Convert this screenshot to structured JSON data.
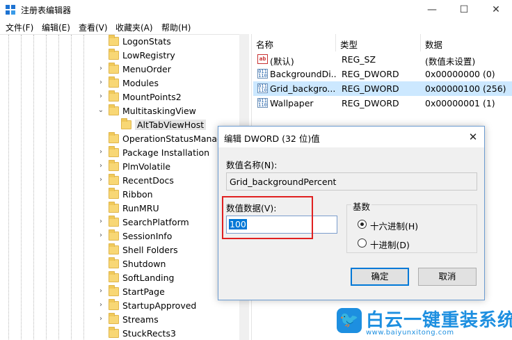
{
  "window": {
    "title": "注册表编辑器",
    "minimize": "—",
    "maximize": "☐",
    "close": "✕"
  },
  "menu": [
    "文件(F)",
    "编辑(E)",
    "查看(V)",
    "收藏夹(A)",
    "帮助(H)"
  ],
  "tree": {
    "items": [
      {
        "label": "LogonStats",
        "expandable": false
      },
      {
        "label": "LowRegistry",
        "expandable": false
      },
      {
        "label": "MenuOrder",
        "expandable": true
      },
      {
        "label": "Modules",
        "expandable": true
      },
      {
        "label": "MountPoints2",
        "expandable": true
      },
      {
        "label": "MultitaskingView",
        "expandable": true,
        "expanded": true
      },
      {
        "label": "AltTabViewHost",
        "expandable": false,
        "child": true,
        "selected": true
      },
      {
        "label": "OperationStatusManag",
        "expandable": false
      },
      {
        "label": "Package Installation",
        "expandable": true
      },
      {
        "label": "PlmVolatile",
        "expandable": true
      },
      {
        "label": "RecentDocs",
        "expandable": true
      },
      {
        "label": "Ribbon",
        "expandable": false
      },
      {
        "label": "RunMRU",
        "expandable": false
      },
      {
        "label": "SearchPlatform",
        "expandable": true
      },
      {
        "label": "SessionInfo",
        "expandable": true
      },
      {
        "label": "Shell Folders",
        "expandable": false
      },
      {
        "label": "Shutdown",
        "expandable": false
      },
      {
        "label": "SoftLanding",
        "expandable": false
      },
      {
        "label": "StartPage",
        "expandable": true
      },
      {
        "label": "StartupApproved",
        "expandable": true
      },
      {
        "label": "Streams",
        "expandable": true
      },
      {
        "label": "StuckRects3",
        "expandable": false
      }
    ]
  },
  "values": {
    "headers": {
      "name": "名称",
      "type": "类型",
      "data": "数据"
    },
    "rows": [
      {
        "icon": "string-value-icon",
        "icon_text": "ab",
        "name": "(默认)",
        "type": "REG_SZ",
        "data": "(数值未设置)",
        "selected": false
      },
      {
        "icon": "binary-value-icon",
        "icon_text": "011 110",
        "name": "BackgroundDi...",
        "type": "REG_DWORD",
        "data": "0x00000000 (0)",
        "selected": false
      },
      {
        "icon": "binary-value-icon",
        "icon_text": "011 110",
        "name": "Grid_backgro...",
        "type": "REG_DWORD",
        "data": "0x00000100 (256)",
        "selected": true
      },
      {
        "icon": "binary-value-icon",
        "icon_text": "011 110",
        "name": "Wallpaper",
        "type": "REG_DWORD",
        "data": "0x00000001 (1)",
        "selected": false
      }
    ]
  },
  "dialog": {
    "title": "编辑 DWORD (32 位)值",
    "close": "✕",
    "name_label": "数值名称(N):",
    "name_value": "Grid_backgroundPercent",
    "data_label": "数值数据(V):",
    "data_value": "100",
    "base_label": "基数",
    "radio_hex": "十六进制(H)",
    "radio_dec": "十进制(D)",
    "base_selected": "hex",
    "ok": "确定",
    "cancel": "取消"
  },
  "watermark": {
    "brand": "白云一键重装系统",
    "url": "www.baiyunxitong.com"
  }
}
